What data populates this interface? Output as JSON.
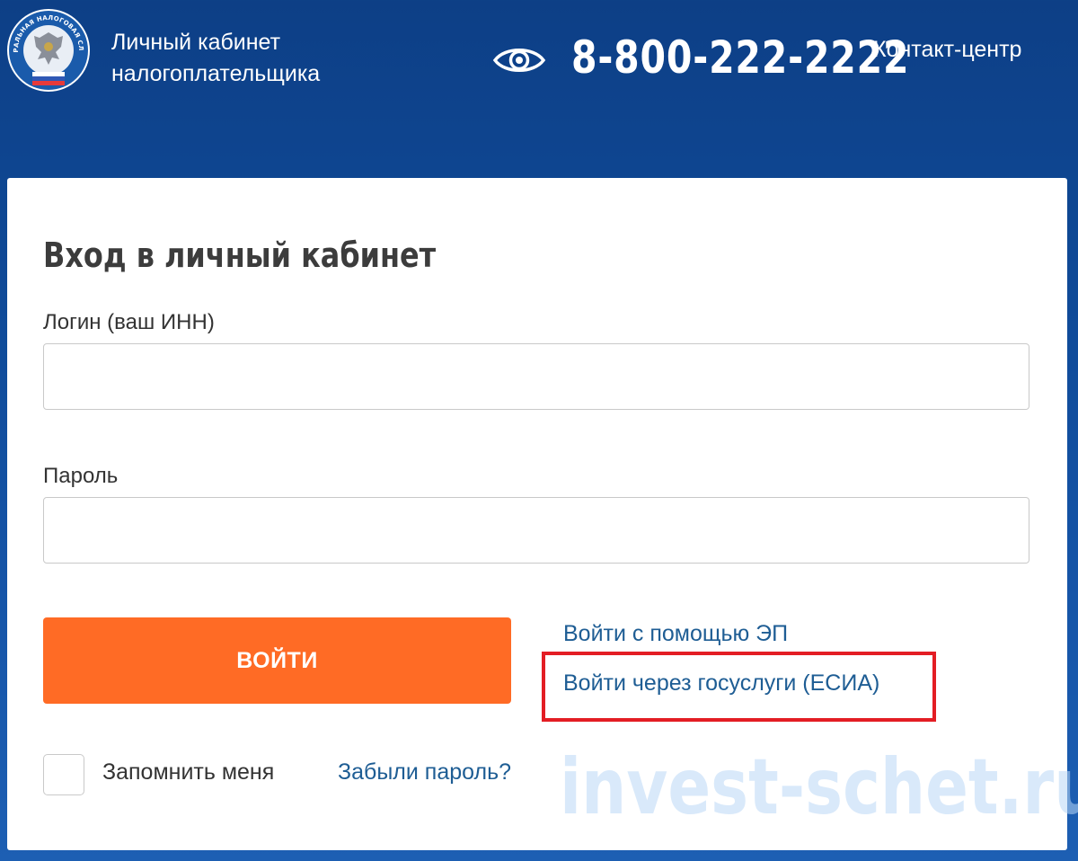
{
  "header": {
    "logo_icon": "fns-emblem-icon",
    "logo_ring_text": "ФЕДЕРАЛЬНАЯ НАЛОГОВАЯ СЛУЖБА",
    "title_line1": "Личный кабинет",
    "title_line2": "налогоплательщика",
    "accessibility_icon": "eye-icon",
    "phone": "8-800-222-2222",
    "contact_label": "Контакт-центр"
  },
  "login": {
    "title": "Вход в личный кабинет",
    "login_label": "Логин (ваш ИНН)",
    "login_value": "",
    "password_label": "Пароль",
    "password_value": "",
    "submit_label": "ВОЙТИ",
    "ep_link": "Войти с помощью ЭП",
    "esia_link": "Войти через госуслуги (ЕСИА)",
    "remember_label": "Запомнить меня",
    "remember_checked": false,
    "forgot_link": "Забыли пароль?"
  },
  "watermark": "invest-schet.ru",
  "colors": {
    "header_background": "#0f4a98",
    "accent_button": "#ff6b25",
    "link": "#1e5d94",
    "highlight_border": "#e31d24",
    "card_background": "#ffffff"
  }
}
